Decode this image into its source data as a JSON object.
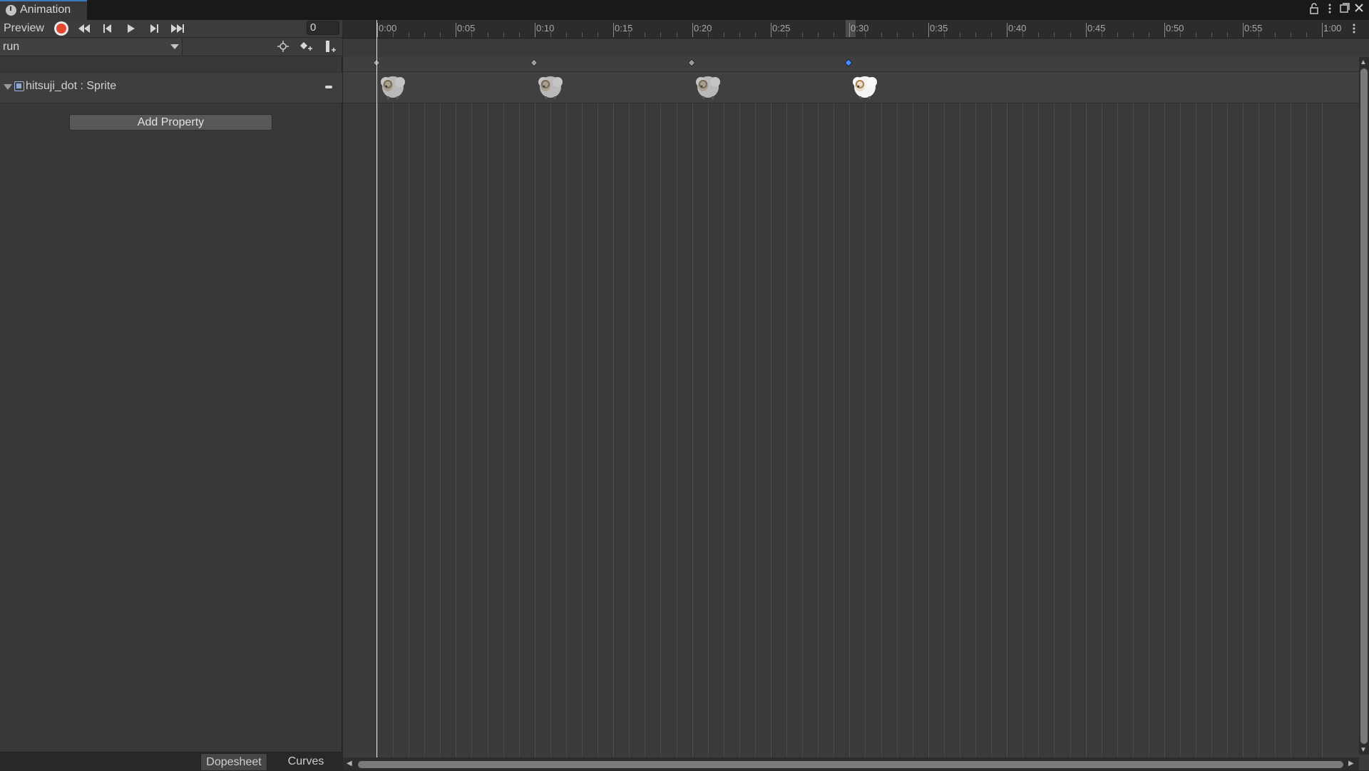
{
  "window": {
    "tab_title": "Animation",
    "icons": [
      "clock-icon",
      "lock-icon",
      "kebab-menu-icon",
      "maximize-icon",
      "close-icon"
    ]
  },
  "toolbar": {
    "preview_label": "Preview",
    "frame_value": "0",
    "buttons": [
      "record-icon",
      "first-keyframe-icon",
      "prev-keyframe-icon",
      "play-icon",
      "next-keyframe-icon",
      "last-keyframe-icon"
    ],
    "record_color": "#e0492f"
  },
  "clip": {
    "name": "run",
    "tool_icons": [
      "filter-by-selection-icon",
      "add-keyframe-icon",
      "add-event-icon"
    ]
  },
  "properties": [
    {
      "label": "hitsuji_dot : Sprite",
      "icon": "sprite-icon"
    }
  ],
  "add_property_label": "Add Property",
  "bottom_tabs": {
    "dopesheet": "Dopesheet",
    "curves": "Curves"
  },
  "timeline": {
    "ruler_labels": [
      "0:00",
      "0:05",
      "0:10",
      "0:15",
      "0:20",
      "0:25",
      "0:30",
      "0:35",
      "0:40",
      "0:45",
      "0:50",
      "0:55",
      "1:00"
    ],
    "current_frame": 0,
    "keyframes": [
      {
        "time": "0:00",
        "selected": false
      },
      {
        "time": "0:10",
        "selected": false
      },
      {
        "time": "0:20",
        "selected": false
      },
      {
        "time": "0:30",
        "selected": true
      }
    ],
    "selection_color": "#4a8bff"
  }
}
